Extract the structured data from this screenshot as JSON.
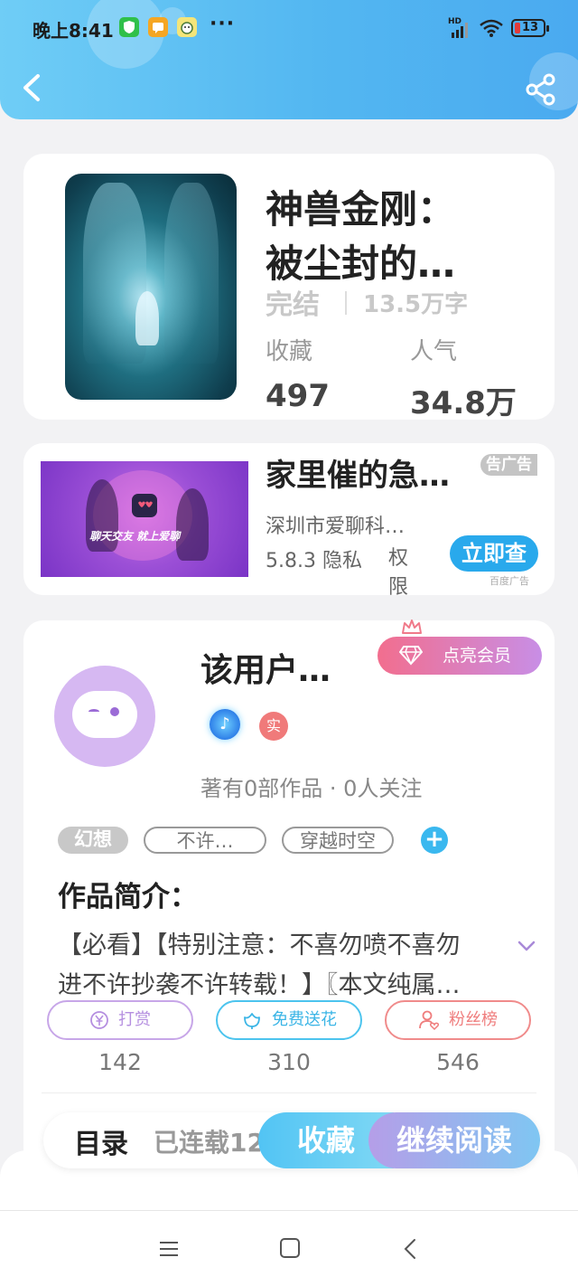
{
  "status_bar": {
    "time": "晚上8:41",
    "more": "···",
    "hd": "HD",
    "battery": "13"
  },
  "book": {
    "title_line1": "神兽金刚：",
    "title_line2": "被尘封的…",
    "status": "完结",
    "word_count": "13.5万字",
    "favorites_label": "收藏",
    "favorites_value": "497",
    "popularity_label": "人气",
    "popularity_value": "34.8万"
  },
  "ad": {
    "title": "家里催的急？…",
    "tag": "告广告",
    "slogan": "聊天交友  就上爱聊",
    "company": "深圳市爱聊科…",
    "version": "5.8.3 隐私",
    "permission": "权限",
    "cta": "立即查",
    "source": "百度广告"
  },
  "author": {
    "name": "该用户…",
    "vip_label": "点亮会员",
    "badge_music": "♪",
    "badge_real": "实",
    "stats": "著有0部作品 · 0人关注",
    "tags": [
      "幻想",
      "不许…",
      "穿越时空"
    ],
    "add_tag": "+",
    "intro_heading": "作品简介：",
    "intro_line1": "【必看】【特别注意：不喜勿喷不喜勿",
    "intro_line2": "进不许抄袭不许转载！】〖本文纯属…",
    "actions": [
      {
        "label": "打赏",
        "count": "142",
        "color": "#c7a6e8",
        "icon": "yuan-icon"
      },
      {
        "label": "免费送花",
        "count": "310",
        "color": "#4cc4ee",
        "icon": "flower-icon"
      },
      {
        "label": "粉丝榜",
        "count": "546",
        "color": "#f08b8b",
        "icon": "fan-icon"
      }
    ]
  },
  "bottom_bar": {
    "toc_label": "目录",
    "serial_label": "已连载12",
    "collect_label": "收藏",
    "read_label": "继续阅读"
  },
  "colors": {
    "header": "#53b7f1",
    "accent": "#29a9ec",
    "vip": "#f26e8e"
  }
}
